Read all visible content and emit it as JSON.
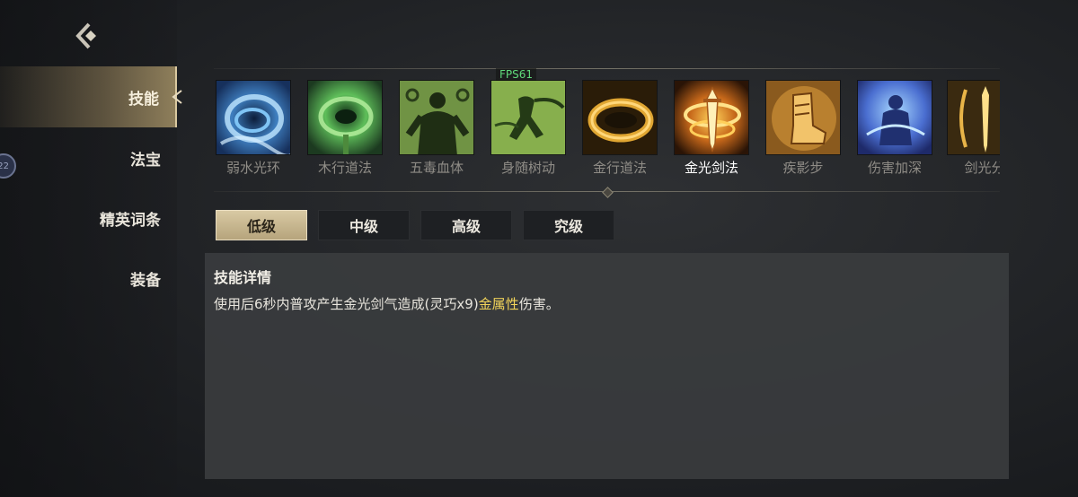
{
  "sidebar": {
    "items": [
      {
        "label": "技能",
        "active": true
      },
      {
        "label": "法宝",
        "active": false
      },
      {
        "label": "精英词条",
        "active": false
      },
      {
        "label": "装备",
        "active": false
      }
    ],
    "badge": "22"
  },
  "overlay": {
    "fps": "FPS61"
  },
  "skills": [
    {
      "name": "弱水光环",
      "icon": "water-ring-icon"
    },
    {
      "name": "木行道法",
      "icon": "wood-vortex-icon"
    },
    {
      "name": "五毒血体",
      "icon": "poison-body-icon"
    },
    {
      "name": "身随树动",
      "icon": "tree-figure-icon"
    },
    {
      "name": "金行道法",
      "icon": "gold-ring-icon"
    },
    {
      "name": "金光剑法",
      "icon": "golden-sword-icon",
      "selected": true
    },
    {
      "name": "疾影步",
      "icon": "swift-boot-icon"
    },
    {
      "name": "伤害加深",
      "icon": "blue-figure-icon"
    },
    {
      "name": "剑光分",
      "icon": "sword-split-icon"
    }
  ],
  "tiers": [
    "低级",
    "中级",
    "高级",
    "究级"
  ],
  "active_tier": "低级",
  "detail": {
    "title": "技能详情",
    "text_before": "使用后6秒内普攻产生金光剑气造成(灵巧x9)",
    "highlight": "金属性",
    "text_after": "伤害。"
  },
  "colors": {
    "accent_gold": "#d8c9a3",
    "highlight_yellow": "#f0d35a",
    "fps_green": "#5fd87a"
  }
}
